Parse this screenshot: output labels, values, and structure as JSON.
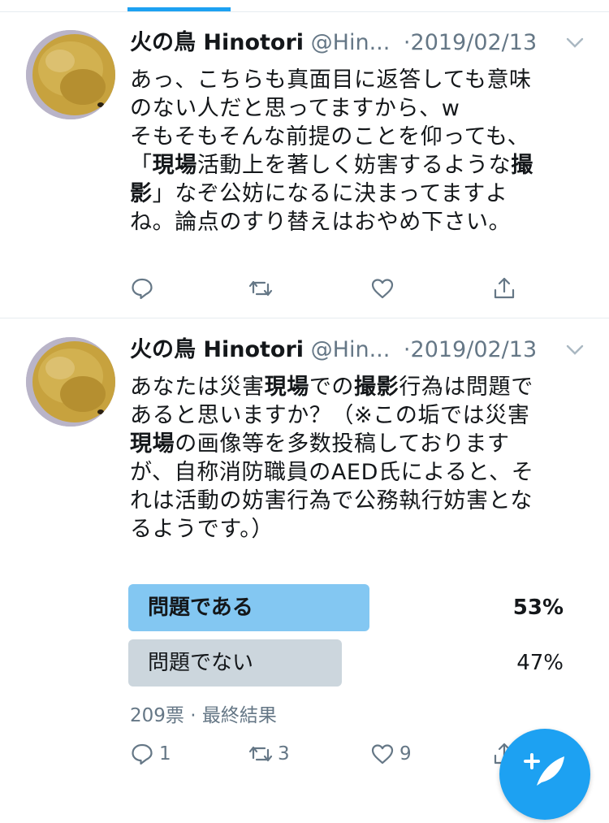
{
  "tweets": [
    {
      "author_name": "火の鳥 Hinotori",
      "handle": "@Hin...",
      "date": "2019/02/13",
      "lines": [
        [
          {
            "t": "あっ、こちらも真面目に返答しても意味",
            "b": false
          }
        ],
        [
          {
            "t": "のない人だと思ってますから、w",
            "b": false
          }
        ],
        [
          {
            "t": "そもそもそんな前提のことを仰っても、",
            "b": false
          }
        ],
        [
          {
            "t": "「",
            "b": false
          },
          {
            "t": "現場",
            "b": true
          },
          {
            "t": "活動上を著しく妨害するような",
            "b": false
          },
          {
            "t": "撮",
            "b": true
          }
        ],
        [
          {
            "t": "影",
            "b": true
          },
          {
            "t": "」なぞ公妨になるに決まってますよ",
            "b": false
          }
        ],
        [
          {
            "t": "ね。論点のすり替えはおやめ下さい。",
            "b": false
          }
        ]
      ],
      "actions": {
        "reply": "",
        "retweet": "",
        "like": ""
      }
    },
    {
      "author_name": "火の鳥 Hinotori",
      "handle": "@Hin...",
      "date": "2019/02/13",
      "lines": [
        [
          {
            "t": "あなたは災害",
            "b": false
          },
          {
            "t": "現場",
            "b": true
          },
          {
            "t": "での",
            "b": false
          },
          {
            "t": "撮影",
            "b": true
          },
          {
            "t": "行為は問題で",
            "b": false
          }
        ],
        [
          {
            "t": "あると思いますか？（※この垢では災害",
            "b": false
          }
        ],
        [
          {
            "t": "現場",
            "b": true
          },
          {
            "t": "の画像等を多数投稿しております",
            "b": false
          }
        ],
        [
          {
            "t": "が、自称消防職員のAED氏によると、そ",
            "b": false
          }
        ],
        [
          {
            "t": "れは活動の妨害行為で公務執行妨害とな",
            "b": false
          }
        ],
        [
          {
            "t": "るようです。）",
            "b": false
          }
        ]
      ],
      "poll": {
        "options": [
          {
            "label": "問題である",
            "pct_text": "53%",
            "value": 0.53,
            "winner": true
          },
          {
            "label": "問題でない",
            "pct_text": "47%",
            "value": 0.47,
            "winner": false
          }
        ],
        "votes": "209票",
        "status": "最終結果"
      },
      "actions": {
        "reply": "1",
        "retweet": "3",
        "like": "9"
      }
    }
  ],
  "colors": {
    "accent": "#1da1f2",
    "poll_winner": "#83c7f2",
    "poll_other": "#ccd6dd",
    "muted": "#657786"
  }
}
